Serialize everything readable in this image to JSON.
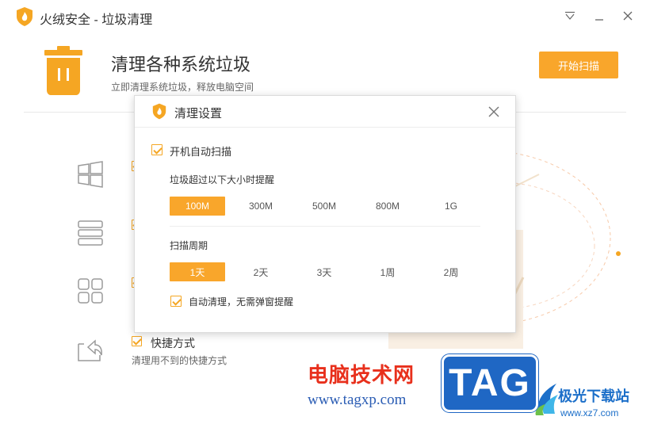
{
  "window": {
    "title": "火绒安全 - 垃圾清理",
    "controls": [
      "menu-icon",
      "minimize-icon",
      "close-icon"
    ]
  },
  "header": {
    "title": "清理各种系统垃圾",
    "subtitle": "立即清理系统垃圾，释放电脑空间",
    "start_button": "开始扫描",
    "accent_color": "#f9a62b"
  },
  "background_list": [
    {
      "icon": "windows-icon",
      "checked": true
    },
    {
      "icon": "database-icon",
      "checked": true
    },
    {
      "icon": "apps-icon",
      "checked": true
    },
    {
      "icon": "shortcut-icon",
      "checked": true,
      "label": "快捷方式",
      "description": "清理用不到的快捷方式"
    }
  ],
  "dialog": {
    "title": "清理设置",
    "auto_scan": {
      "label": "开机自动扫描",
      "checked": true
    },
    "size_threshold": {
      "label": "垃圾超过以下大小时提醒",
      "options": [
        "100M",
        "300M",
        "500M",
        "800M",
        "1G"
      ],
      "selected": "100M"
    },
    "scan_period": {
      "label": "扫描周期",
      "options": [
        "1天",
        "2天",
        "3天",
        "1周",
        "2周"
      ],
      "selected": "1天"
    },
    "auto_clean": {
      "label": "自动清理，无需弹窗提醒",
      "checked": true
    }
  },
  "watermarks": {
    "site_name": "电脑技术网",
    "site_url": "www.tagxp.com",
    "badge": "TAG",
    "brand_name": "极光下载站",
    "brand_url": "www.xz7.com"
  }
}
